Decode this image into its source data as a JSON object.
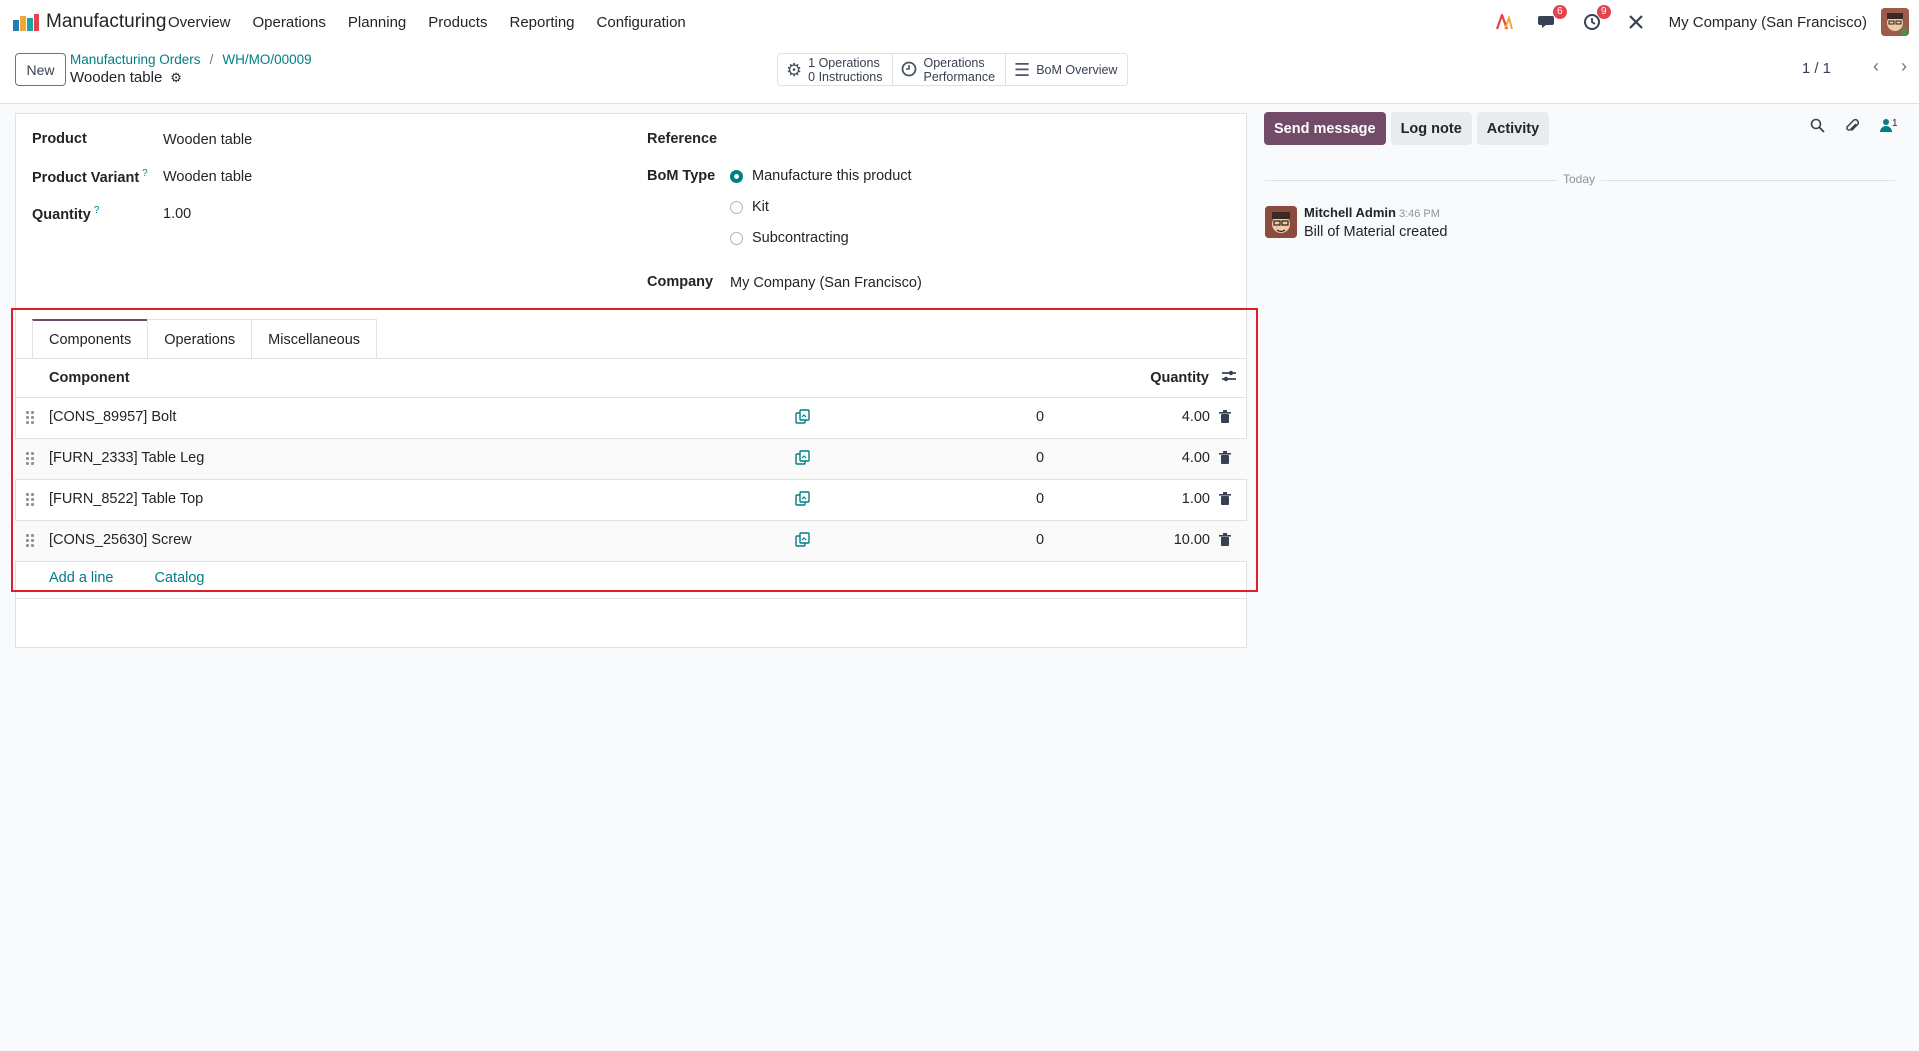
{
  "app": {
    "name": "Manufacturing"
  },
  "menu": [
    "Overview",
    "Operations",
    "Planning",
    "Products",
    "Reporting",
    "Configuration"
  ],
  "systray": {
    "messages_count": "6",
    "activities_count": "9",
    "company": "My Company (San Francisco)"
  },
  "control": {
    "new_label": "New",
    "breadcrumb": [
      "Manufacturing Orders",
      "WH/MO/00009"
    ],
    "title": "Wooden table",
    "smart_buttons": {
      "operations_line1": "1 Operations",
      "operations_line2": "0 Instructions",
      "performance_line1": "Operations",
      "performance_line2": "Performance",
      "bom_overview": "BoM Overview"
    },
    "pager": "1 / 1"
  },
  "form": {
    "product_label": "Product",
    "product_value": "Wooden table",
    "variant_label": "Product Variant",
    "variant_value": "Wooden table",
    "quantity_label": "Quantity",
    "quantity_value": "1.00",
    "help_mark": "?",
    "reference_label": "Reference",
    "bom_type_label": "BoM Type",
    "bom_types": [
      "Manufacture this product",
      "Kit",
      "Subcontracting"
    ],
    "bom_type_selected": "Manufacture this product",
    "company_label": "Company",
    "company_value": "My Company (San Francisco)"
  },
  "tabs": [
    "Components",
    "Operations",
    "Miscellaneous"
  ],
  "components": {
    "header_component": "Component",
    "header_quantity": "Quantity",
    "rows": [
      {
        "name": "[CONS_89957] Bolt",
        "available": "0",
        "quantity": "4.00"
      },
      {
        "name": "[FURN_2333] Table Leg",
        "available": "0",
        "quantity": "4.00"
      },
      {
        "name": "[FURN_8522] Table Top",
        "available": "0",
        "quantity": "1.00"
      },
      {
        "name": "[CONS_25630] Screw",
        "available": "0",
        "quantity": "10.00"
      }
    ],
    "add_line": "Add a line",
    "catalog": "Catalog"
  },
  "chatter": {
    "send_message": "Send message",
    "log_note": "Log note",
    "activity": "Activity",
    "followers_count": "1",
    "date_separator": "Today",
    "message": {
      "author": "Mitchell Admin",
      "time": "3:46 PM",
      "body": "Bill of Material created"
    }
  },
  "colors": {
    "accent": "#714b67",
    "link": "#017e84",
    "highlight": "#e11d2a"
  }
}
